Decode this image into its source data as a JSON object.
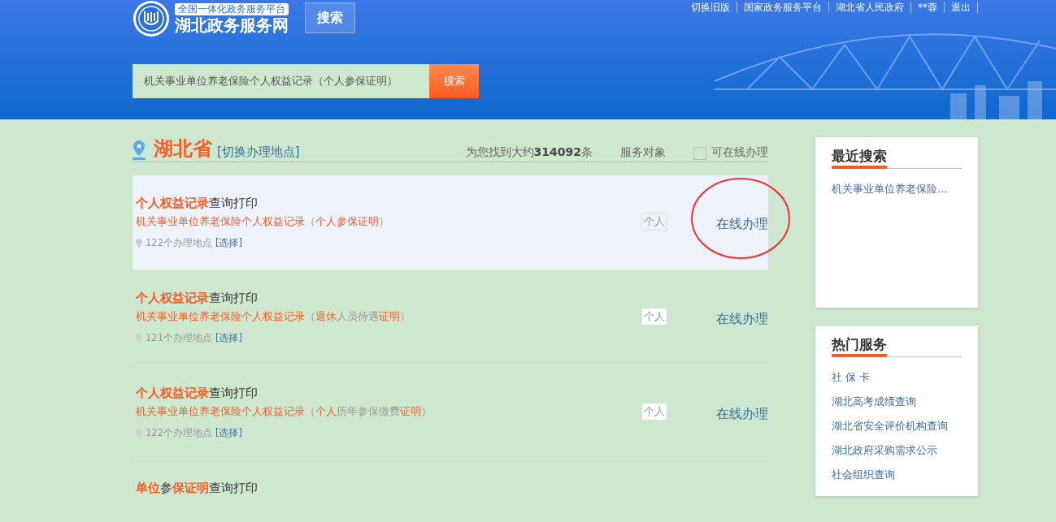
{
  "header": {
    "platform_tag": "全国一体化政务服务平台",
    "site_title": "湖北政务服务网",
    "search_button": "搜索",
    "top_links": [
      "切换旧版",
      "国家政务服务平台",
      "湖北省人民政府",
      "**蓉",
      "退出"
    ],
    "search": {
      "value": "机关事业单位养老保险个人权益记录（个人参保证明）",
      "button": "搜索"
    }
  },
  "results": {
    "region": "湖北省",
    "switch_link": "[切换办理地点]",
    "count_text": "为您找到大约**314092**条",
    "service_target": "服务对象",
    "online_filter": {
      "label": "可在线办理",
      "checked": false
    },
    "items": [
      {
        "title": "**个人权益记录**查询打印",
        "subtitle": "**机关事业单位养老保险个人权益记录**（**个人参保证明**）",
        "locations": "122个办理地点",
        "choose": "[选择]",
        "target": "个人",
        "action": "在线办理",
        "selected": true,
        "circled": true
      },
      {
        "title": "**个人权益记录**查询打印",
        "subtitle": "**机关事业单位养老保险个人权益记录**（**退休**人员待遇**证明**）",
        "locations": "121个办理地点",
        "choose": "[选择]",
        "target": "个人",
        "action": "在线办理",
        "selected": false,
        "circled": false
      },
      {
        "title": "**个人权益记录**查询打印",
        "subtitle": "**机关事业单位养老保险个人权益记录**（**个人**历年参保缴费**证明**）",
        "locations": "122个办理地点",
        "choose": "[选择]",
        "target": "个人",
        "action": "在线办理",
        "selected": false,
        "circled": false
      },
      {
        "title": "**单位**参**保证明**查询打印",
        "selected": false,
        "circled": false
      }
    ]
  },
  "sidebar": [
    {
      "title": "最近搜索",
      "links": [
        "机关事业单位养老保险..."
      ]
    },
    {
      "title": "热门服务",
      "links": [
        "社 保 卡",
        "湖北高考成绩查询",
        "湖北省安全评价机构查询",
        "湖北政府采购需求公示",
        "社会组织查询"
      ]
    }
  ]
}
